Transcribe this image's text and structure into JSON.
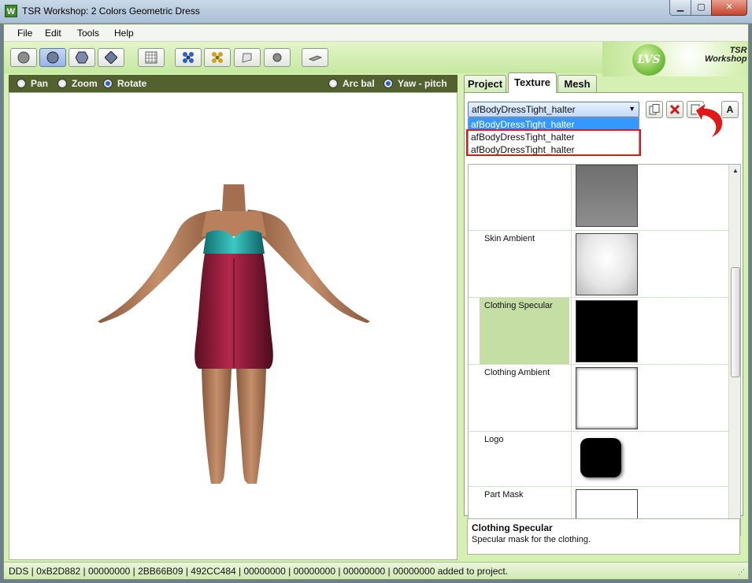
{
  "window": {
    "title": "TSR Workshop: 2 Colors Geometric Dress",
    "app_icon": "W",
    "min": "▁",
    "max": "▢",
    "close": "✕"
  },
  "menu": [
    "File",
    "Edit",
    "Tools",
    "Help"
  ],
  "logo": {
    "badge": "LVS",
    "brand_line1": "TSR",
    "brand_line2": "Workshop"
  },
  "viewport": {
    "modes": [
      {
        "label": "Pan",
        "selected": false
      },
      {
        "label": "Zoom",
        "selected": false
      },
      {
        "label": "Rotate",
        "selected": true
      }
    ],
    "camera": [
      {
        "label": "Arc bal",
        "selected": false
      },
      {
        "label": "Yaw - pitch",
        "selected": true
      }
    ]
  },
  "tabs": [
    {
      "label": "Project",
      "active": false
    },
    {
      "label": "Texture",
      "active": true
    },
    {
      "label": "Mesh",
      "active": false
    }
  ],
  "texture": {
    "combo_value": "afBodyDressTight_halter",
    "combo_arrow": "▼",
    "side_button_label": "A",
    "dropdown_items": [
      "afBodyDressTight_halter",
      "afBodyDressTight_halter",
      "afBodyDressTight_halter"
    ],
    "rows": [
      {
        "label": "",
        "selected": false
      },
      {
        "label": "Skin Ambient",
        "selected": false
      },
      {
        "label": "Clothing Specular",
        "selected": true
      },
      {
        "label": "Clothing Ambient",
        "selected": false
      },
      {
        "label": "Logo",
        "selected": false
      },
      {
        "label": "Part Mask",
        "selected": false
      }
    ],
    "description": {
      "title": "Clothing Specular",
      "text": "Specular mask for the clothing."
    }
  },
  "status": "DDS | 0xB2D882 | 00000000 | 2BB66B09 | 492CC484 | 00000000 | 00000000 | 00000000 | 00000000 added to project.",
  "colors": {
    "frame": "#d6efb3",
    "viewbar": "#53612f",
    "selection": "#3399ff",
    "highlight": "#e01818"
  }
}
